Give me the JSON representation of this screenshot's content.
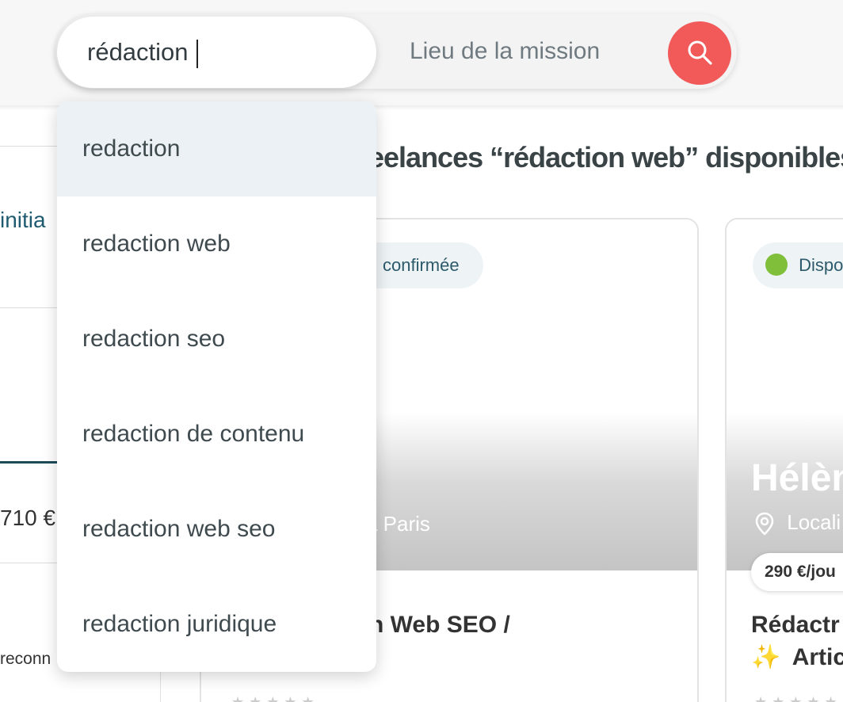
{
  "search": {
    "query": "rédaction",
    "location_placeholder": "Lieu de la mission",
    "submit_icon": "search-icon",
    "button_color": "#f25a5a"
  },
  "suggestions": [
    "redaction",
    "redaction web",
    "redaction seo",
    "redaction de contenu",
    "redaction web seo",
    "redaction juridique"
  ],
  "results": {
    "heading_partial": "eelances “rédaction web” disponibles"
  },
  "sidebar": {
    "tab_partial": "initia",
    "price_partial": "710 €",
    "text_partial": "reconn"
  },
  "cards": [
    {
      "badge_partial": "confirmée",
      "location_partial": "a Paris",
      "title_partial": "n Web SEO /"
    },
    {
      "badge_partial": "Dispo",
      "name_partial": "Hélèn",
      "location_partial": "Locali",
      "price": "290 €/jou",
      "title_line1_partial": "Rédactr",
      "title_line2_partial": "Artic",
      "emoji": "✨"
    }
  ]
}
